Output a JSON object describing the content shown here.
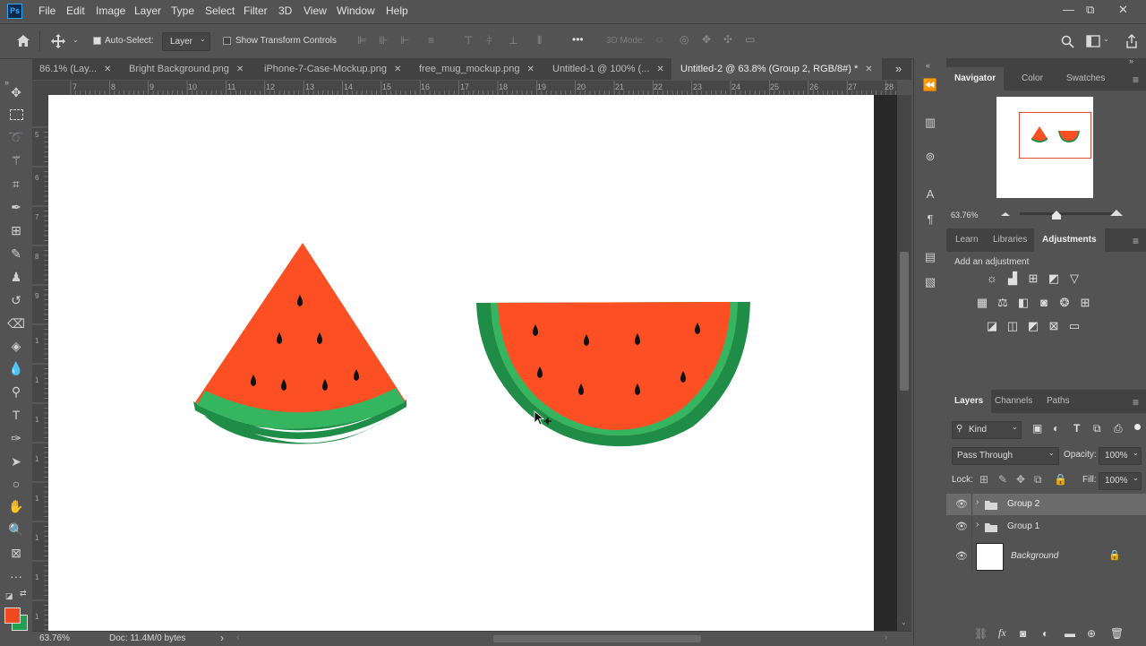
{
  "app": {
    "logo": "Ps"
  },
  "menu": [
    "File",
    "Edit",
    "Image",
    "Layer",
    "Type",
    "Select",
    "Filter",
    "3D",
    "View",
    "Window",
    "Help"
  ],
  "window_controls": {
    "minimize": "—",
    "restore": "⧉",
    "close": "✕"
  },
  "options": {
    "auto_select_label": "Auto-Select:",
    "auto_select_checked": true,
    "auto_select_target": "Layer",
    "transform_controls_label": "Show Transform Controls",
    "mode_3d_label": "3D Mode:",
    "more": "•••"
  },
  "tabs": [
    {
      "label": "86.1% (Lay...",
      "active": false
    },
    {
      "label": "Bright Background.png",
      "active": false
    },
    {
      "label": "iPhone-7-Case-Mockup.png",
      "active": false
    },
    {
      "label": "free_mug_mockup.png",
      "active": false
    },
    {
      "label": "Untitled-1 @ 100% (...",
      "active": false
    },
    {
      "label": "Untitled-2 @ 63.8% (Group 2, RGB/8#) *",
      "active": true
    }
  ],
  "tab_close": "✕",
  "tab_overflow": "»",
  "ruler_top": [
    "7",
    "8",
    "9",
    "10",
    "11",
    "12",
    "13",
    "14",
    "15",
    "16",
    "17",
    "18",
    "19",
    "20",
    "21",
    "22",
    "23",
    "24",
    "25",
    "26",
    "27",
    "28"
  ],
  "ruler_left": [
    "5",
    "6",
    "7",
    "8",
    "9",
    "1",
    "1",
    "1",
    "1",
    "1",
    "1",
    "1",
    "1"
  ],
  "status": {
    "zoom": "63.76%",
    "doc": "Doc: 11.4M/0 bytes",
    "arrow": "›"
  },
  "navigator": {
    "tabs": [
      "Navigator",
      "Color",
      "Swatches"
    ],
    "zoom": "63.76%"
  },
  "adjustments": {
    "tabs": [
      "Learn",
      "Libraries",
      "Adjustments"
    ],
    "add_label": "Add an adjustment"
  },
  "layers": {
    "tabs": [
      "Layers",
      "Channels",
      "Paths"
    ],
    "filter_kind": "Kind",
    "blend_mode": "Pass Through",
    "opacity_label": "Opacity:",
    "opacity_value": "100%",
    "lock_label": "Lock:",
    "fill_label": "Fill:",
    "fill_value": "100%",
    "items": [
      {
        "name": "Group 2",
        "type": "group",
        "selected": true
      },
      {
        "name": "Group 1",
        "type": "group",
        "selected": false
      },
      {
        "name": "Background",
        "type": "background",
        "selected": false
      }
    ]
  },
  "colors": {
    "foreground": "#f04a23",
    "background": "#20a050",
    "watermelon_flesh": "#fd4f24",
    "rind_dark": "#1f8c47",
    "rind_light": "#36b560",
    "seed": "#111111"
  }
}
